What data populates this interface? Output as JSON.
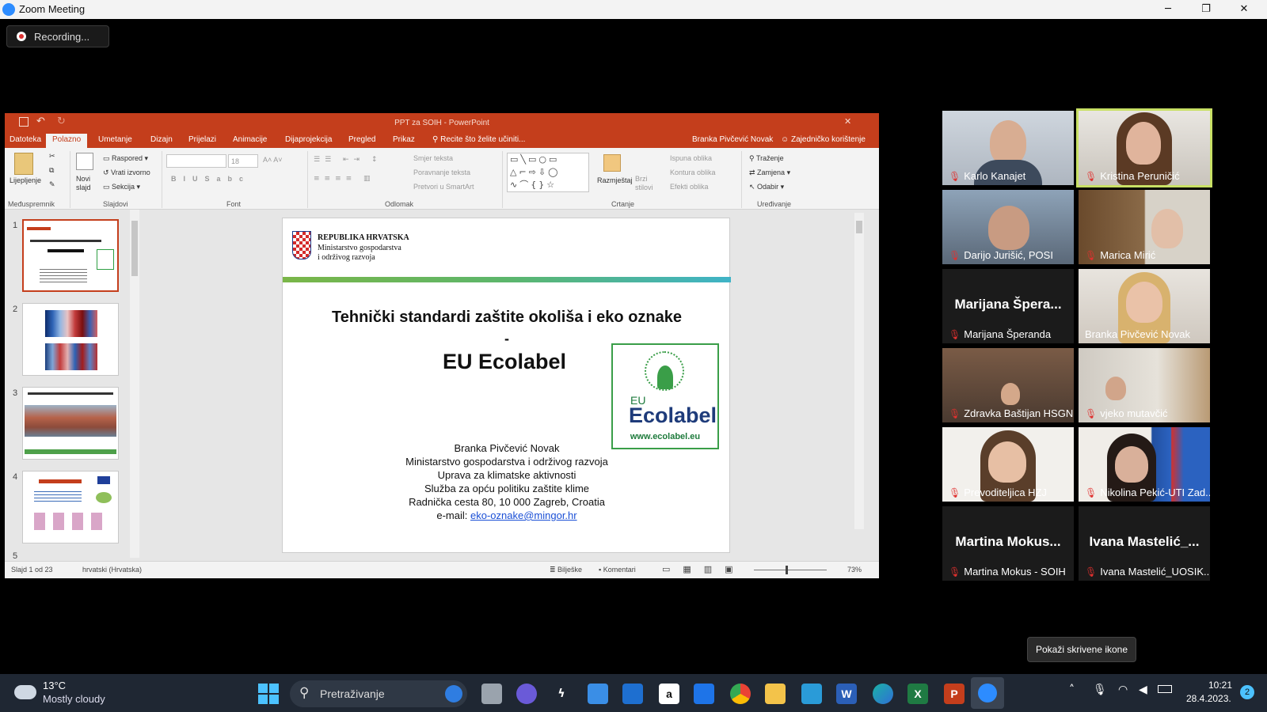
{
  "window": {
    "title": "Zoom Meeting",
    "minimize": "─",
    "restore": "❐",
    "close": "✕"
  },
  "recording": {
    "label": "Recording..."
  },
  "ppt": {
    "title": "PPT za SOIH - PowerPoint",
    "user": "Branka Pivčević Novak",
    "share": "Zajedničko korištenje",
    "tabs": [
      "Datoteka",
      "Polazno",
      "Umetanje",
      "Dizajn",
      "Prijelazi",
      "Animacije",
      "Dijaprojekcija",
      "Pregled",
      "Prikaz"
    ],
    "tell_me": "Recite što želite učiniti...",
    "ribbon": {
      "paste": "Lijepljenje",
      "new_slide": "Novi slajd",
      "layout": "Raspored",
      "reset": "Vrati izvorno",
      "section": "Sekcija",
      "font_size": "18",
      "text_direction": "Smjer teksta",
      "align_text": "Poravnanje teksta",
      "smartart": "Pretvori u SmartArt",
      "arrange": "Razmještaj",
      "quick_styles": "Brzi stilovi",
      "shape_fill": "Ispuna oblika",
      "shape_outline": "Kontura oblika",
      "shape_effects": "Efekti oblika",
      "find": "Traženje",
      "replace": "Zamjena",
      "select": "Odabir",
      "groups": [
        "Međuspremnik",
        "Slajdovi",
        "Font",
        "Odlomak",
        "Crtanje",
        "Uređivanje"
      ]
    },
    "thumbnails": [
      "1",
      "2",
      "3",
      "4",
      "5"
    ],
    "slide": {
      "gov1": "REPUBLIKA HRVATSKA",
      "gov2": "Ministarstvo gospodarstva",
      "gov3": "i održivog razvoja",
      "title": "Tehnički standardi zaštite okoliša i eko oznake",
      "dash": "-",
      "subtitle": "EU Ecolabel",
      "logo_eu": "EU",
      "logo_name": "Ecolabel",
      "logo_url": "www.ecolabel.eu",
      "author": "Branka Pivčević Novak",
      "ministry": "Ministarstvo gospodarstva i održivog razvoja",
      "dept": "Uprava za klimatske aktivnosti",
      "service": "Služba za opću politiku zaštite klime",
      "address": "Radnička cesta 80, 10 000 Zagreb, Croatia",
      "email_label": "e-mail: ",
      "email": "eko-oznake@mingor.hr"
    },
    "status": {
      "slide": "Slajd 1 od 23",
      "lang": "hrvatski (Hrvatska)",
      "notes": "Bilješke",
      "comments": "Komentari",
      "zoom": "73%"
    }
  },
  "participants": [
    {
      "name": "Karlo Kanajet"
    },
    {
      "name": "Kristina Peruničić"
    },
    {
      "name": "Darijo Jurišić, POSI"
    },
    {
      "name": "Marica Mirić"
    },
    {
      "name": "Marijana Šperanda",
      "display": "Marijana Špera..."
    },
    {
      "name": "Branka Pivčević Novak"
    },
    {
      "name": "Zdravka Baštijan HSGN"
    },
    {
      "name": "vjeko mutavčić"
    },
    {
      "name": "Prevoditeljica HZJ"
    },
    {
      "name": "Nikolina Pekić-UTI Zad..."
    },
    {
      "name": "Martina Mokus - SOIH",
      "display": "Martina Mokus..."
    },
    {
      "name": "Ivana Mastelić_UOSIK...",
      "display": "Ivana Mastelić_..."
    }
  ],
  "tooltip": "Pokaži skrivene ikone",
  "taskbar": {
    "weather_temp": "13°C",
    "weather_desc": "Mostly cloudy",
    "search": "Pretraživanje",
    "time": "10:21",
    "date": "28.4.2023.",
    "notifications": "2"
  },
  "colors": {
    "ppt_accent": "#c43e1c",
    "zoom_blue": "#2d8cff",
    "active_speaker": "#c8e065"
  }
}
